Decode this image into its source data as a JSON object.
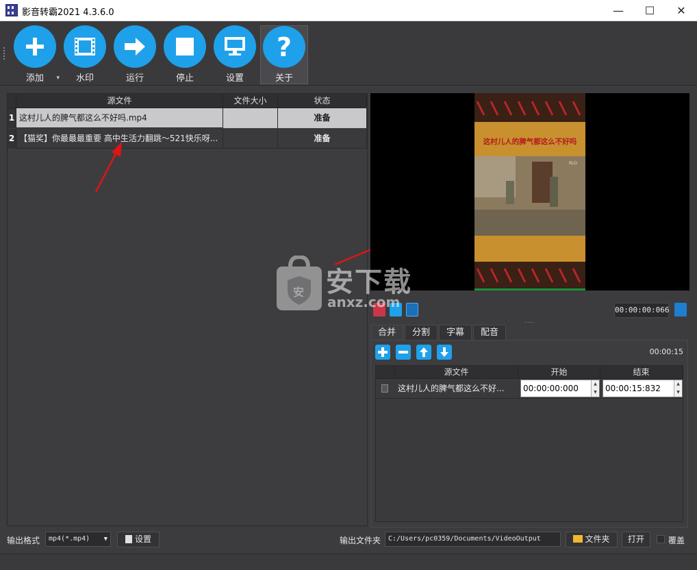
{
  "window": {
    "title": "影音转霸2021 4.3.6.0",
    "minimize": "—",
    "maximize": "☐",
    "close": "✕"
  },
  "toolbar": {
    "add": "添加",
    "watermark": "水印",
    "run": "运行",
    "stop": "停止",
    "settings": "设置",
    "about": "关于",
    "about_glyph": "?",
    "add_dropdown": "▾",
    "accent": "#1ea1ea"
  },
  "file_list": {
    "columns": [
      "源文件",
      "文件大小",
      "状态"
    ],
    "rows": [
      {
        "num": "1",
        "name": "这村儿人的脾气都这么不好吗.mp4",
        "size": "",
        "status": "准备"
      },
      {
        "num": "2",
        "name": "【猫奖】你最最最重要 高中生活力翻跳～521快乐呀...",
        "size": "",
        "status": "准备"
      }
    ]
  },
  "preview": {
    "caption": "这村儿人的脾气都这么不好吗",
    "time": "00:00:00:066",
    "splitter": "......",
    "corner_mark": "RLO"
  },
  "tabs": [
    "合并",
    "分割",
    "字幕",
    "配音"
  ],
  "merge": {
    "total_time": "00:00:15",
    "columns": [
      "源文件",
      "开始",
      "结束"
    ],
    "rows": [
      {
        "name": "这村儿人的脾气都这么不好...",
        "start": "00:00:00:000",
        "end": "00:00:15:832"
      }
    ]
  },
  "bottom": {
    "format_label": "输出格式",
    "format_value": "mp4(*.mp4)",
    "format_settings": "设置",
    "folder_label": "输出文件夹",
    "folder_path": "C:/Users/pc0359/Documents/VideoOutput",
    "folder_button": "文件夹",
    "open_button": "打开",
    "overwrite": "覆盖"
  },
  "watermark": {
    "text_main": "安下载",
    "text_sub": "anxz.com",
    "badge": "安"
  }
}
